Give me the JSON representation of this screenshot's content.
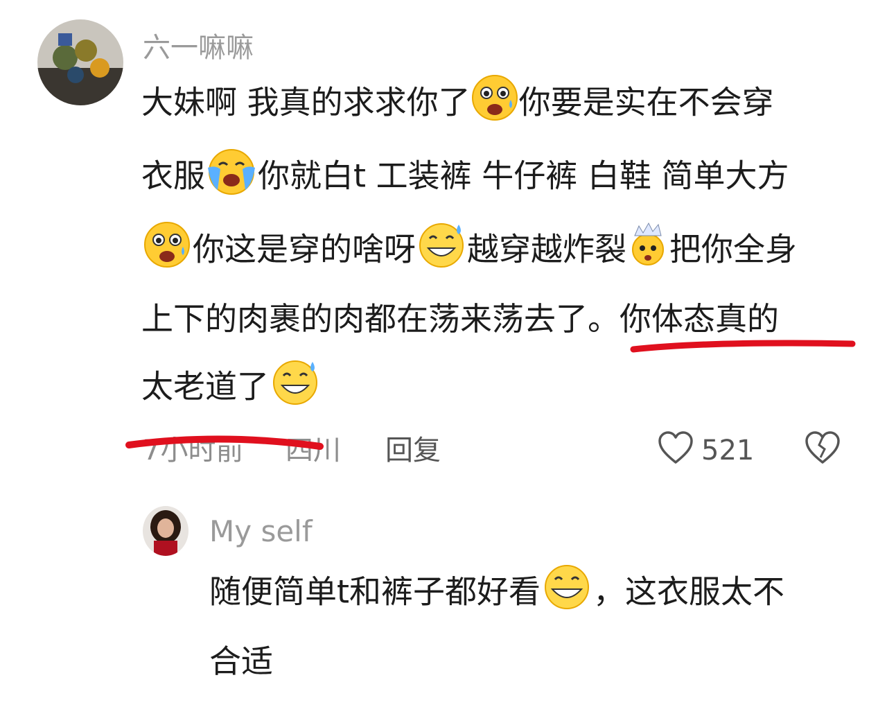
{
  "comment1": {
    "username": "六一嘛嘛",
    "lines": [
      [
        "大妹啊 我真的求求你了",
        "你要是实在不会穿"
      ],
      [
        "衣服",
        "你就白t 工装裤 牛仔裤 白鞋 简单大方"
      ],
      [
        "",
        "你这是穿的啥呀",
        "越穿越炸裂",
        "把你全身"
      ],
      [
        "上下的肉裹的肉都在荡来荡去了。你体态真的"
      ],
      [
        "太老道了"
      ]
    ],
    "time": "7小时前",
    "location": "四川",
    "reply_label": "回复",
    "like_count": "521",
    "icons": [
      "heart-icon",
      "broken-heart-icon"
    ]
  },
  "comment2": {
    "username": "My self",
    "lines": [
      [
        "随便简单t和裤子都好看",
        "，这衣服太不"
      ],
      [
        "合适"
      ]
    ]
  },
  "colors": {
    "annotation_red": "#e0101e",
    "meta_gray": "#8d8d8d"
  }
}
